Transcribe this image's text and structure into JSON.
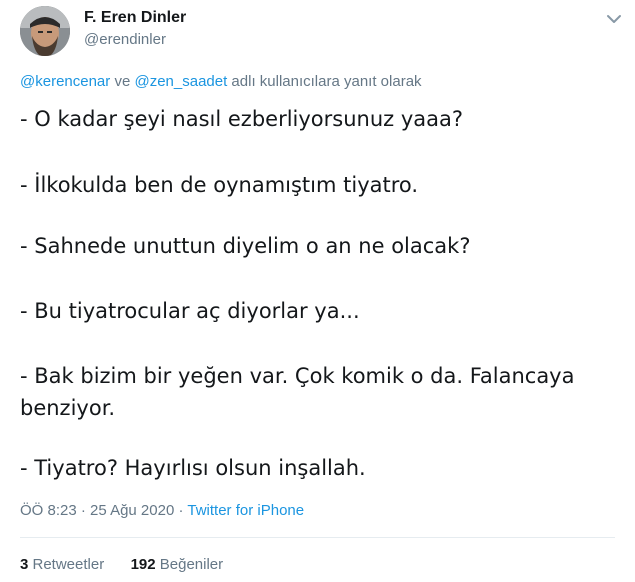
{
  "author": {
    "name": "F. Eren Dinler",
    "handle": "@erendinler"
  },
  "reply_to": {
    "mention_1": "@kerencenar",
    "conjunction": " ve ",
    "mention_2": "@zen_saadet",
    "suffix": " adlı kullanıcılara yanıt olarak"
  },
  "tweet_lines": [
    "- O kadar şeyi nasıl ezberliyorsunuz yaaa?",
    "- İlkokulda ben de oynamıştım tiyatro.",
    "- Sahnede unuttun diyelim o an ne olacak?",
    "- Bu tiyatrocular aç diyorlar ya...",
    "- Bak bizim bir yeğen var. Çok komik o da. Falancaya",
    "benziyor.",
    "- Tiyatro? Hayırlısı olsun inşallah."
  ],
  "meta": {
    "time": "ÖÖ 8:23",
    "separator": " · ",
    "date": "25 Ağu 2020",
    "source": "Twitter for iPhone"
  },
  "stats": {
    "retweets_count": "3",
    "retweets_label": " Retweetler",
    "likes_count": "192",
    "likes_label": " Beğeniler"
  },
  "icons": {
    "menu": "chevron-down-icon",
    "avatar": "profile-photo"
  },
  "colors": {
    "link": "#1b95e0",
    "secondary": "#657786",
    "text": "#14171a",
    "divider": "#e6ecf0"
  }
}
